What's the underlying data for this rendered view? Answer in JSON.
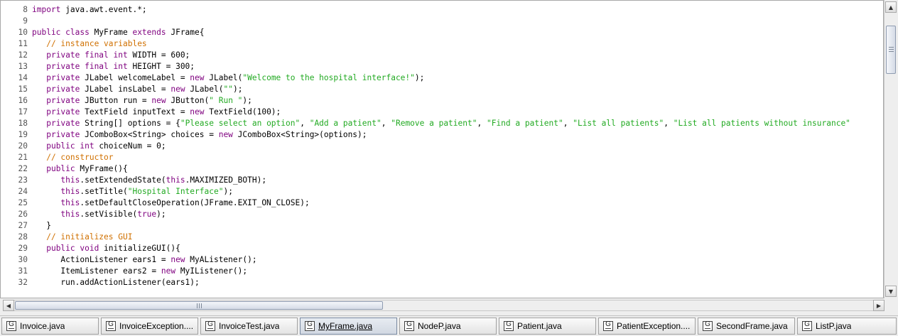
{
  "editor": {
    "lines": [
      {
        "n": "8",
        "tokens": [
          {
            "c": "kw",
            "t": "import"
          },
          {
            "c": "",
            "t": " java.awt.event.*;"
          }
        ]
      },
      {
        "n": "9",
        "tokens": []
      },
      {
        "n": "10",
        "tokens": [
          {
            "c": "kw",
            "t": "public class"
          },
          {
            "c": "",
            "t": " MyFrame "
          },
          {
            "c": "kw",
            "t": "extends"
          },
          {
            "c": "",
            "t": " JFrame{"
          }
        ]
      },
      {
        "n": "11",
        "tokens": [
          {
            "c": "",
            "t": "   "
          },
          {
            "c": "cmt",
            "t": "// instance variables"
          }
        ]
      },
      {
        "n": "12",
        "tokens": [
          {
            "c": "",
            "t": "   "
          },
          {
            "c": "kw",
            "t": "private final int"
          },
          {
            "c": "",
            "t": " WIDTH = 600;"
          }
        ]
      },
      {
        "n": "13",
        "tokens": [
          {
            "c": "",
            "t": "   "
          },
          {
            "c": "kw",
            "t": "private final int"
          },
          {
            "c": "",
            "t": " HEIGHT = 300;"
          }
        ]
      },
      {
        "n": "14",
        "tokens": [
          {
            "c": "",
            "t": "   "
          },
          {
            "c": "kw",
            "t": "private"
          },
          {
            "c": "",
            "t": " JLabel welcomeLabel = "
          },
          {
            "c": "kw",
            "t": "new"
          },
          {
            "c": "",
            "t": " JLabel("
          },
          {
            "c": "str",
            "t": "\"Welcome to the hospital interface!\""
          },
          {
            "c": "",
            "t": ");"
          }
        ]
      },
      {
        "n": "15",
        "tokens": [
          {
            "c": "",
            "t": "   "
          },
          {
            "c": "kw",
            "t": "private"
          },
          {
            "c": "",
            "t": " JLabel insLabel = "
          },
          {
            "c": "kw",
            "t": "new"
          },
          {
            "c": "",
            "t": " JLabel("
          },
          {
            "c": "str",
            "t": "\"\""
          },
          {
            "c": "",
            "t": ");"
          }
        ]
      },
      {
        "n": "16",
        "tokens": [
          {
            "c": "",
            "t": "   "
          },
          {
            "c": "kw",
            "t": "private"
          },
          {
            "c": "",
            "t": " JButton run = "
          },
          {
            "c": "kw",
            "t": "new"
          },
          {
            "c": "",
            "t": " JButton("
          },
          {
            "c": "str",
            "t": "\" Run \""
          },
          {
            "c": "",
            "t": ");"
          }
        ]
      },
      {
        "n": "17",
        "tokens": [
          {
            "c": "",
            "t": "   "
          },
          {
            "c": "kw",
            "t": "private"
          },
          {
            "c": "",
            "t": " TextField inputText = "
          },
          {
            "c": "kw",
            "t": "new"
          },
          {
            "c": "",
            "t": " TextField(100);"
          }
        ]
      },
      {
        "n": "18",
        "tokens": [
          {
            "c": "",
            "t": "   "
          },
          {
            "c": "kw",
            "t": "private"
          },
          {
            "c": "",
            "t": " String[] options = {"
          },
          {
            "c": "str",
            "t": "\"Please select an option\""
          },
          {
            "c": "",
            "t": ", "
          },
          {
            "c": "str",
            "t": "\"Add a patient\""
          },
          {
            "c": "",
            "t": ", "
          },
          {
            "c": "str",
            "t": "\"Remove a patient\""
          },
          {
            "c": "",
            "t": ", "
          },
          {
            "c": "str",
            "t": "\"Find a patient\""
          },
          {
            "c": "",
            "t": ", "
          },
          {
            "c": "str",
            "t": "\"List all patients\""
          },
          {
            "c": "",
            "t": ", "
          },
          {
            "c": "str",
            "t": "\"List all patients without insurance\""
          }
        ]
      },
      {
        "n": "19",
        "tokens": [
          {
            "c": "",
            "t": "   "
          },
          {
            "c": "kw",
            "t": "private"
          },
          {
            "c": "",
            "t": " JComboBox<String> choices = "
          },
          {
            "c": "kw",
            "t": "new"
          },
          {
            "c": "",
            "t": " JComboBox<String>(options);"
          }
        ]
      },
      {
        "n": "20",
        "tokens": [
          {
            "c": "",
            "t": "   "
          },
          {
            "c": "kw",
            "t": "public int"
          },
          {
            "c": "",
            "t": " choiceNum = 0;"
          }
        ]
      },
      {
        "n": "21",
        "tokens": [
          {
            "c": "",
            "t": "   "
          },
          {
            "c": "cmt",
            "t": "// constructor"
          }
        ]
      },
      {
        "n": "22",
        "tokens": [
          {
            "c": "",
            "t": "   "
          },
          {
            "c": "kw",
            "t": "public"
          },
          {
            "c": "",
            "t": " MyFrame(){"
          }
        ]
      },
      {
        "n": "23",
        "tokens": [
          {
            "c": "",
            "t": "      "
          },
          {
            "c": "kw",
            "t": "this"
          },
          {
            "c": "",
            "t": ".setExtendedState("
          },
          {
            "c": "kw",
            "t": "this"
          },
          {
            "c": "",
            "t": ".MAXIMIZED_BOTH);"
          }
        ]
      },
      {
        "n": "24",
        "tokens": [
          {
            "c": "",
            "t": "      "
          },
          {
            "c": "kw",
            "t": "this"
          },
          {
            "c": "",
            "t": ".setTitle("
          },
          {
            "c": "str",
            "t": "\"Hospital Interface\""
          },
          {
            "c": "",
            "t": ");"
          }
        ]
      },
      {
        "n": "25",
        "tokens": [
          {
            "c": "",
            "t": "      "
          },
          {
            "c": "kw",
            "t": "this"
          },
          {
            "c": "",
            "t": ".setDefaultCloseOperation(JFrame.EXIT_ON_CLOSE);"
          }
        ]
      },
      {
        "n": "26",
        "tokens": [
          {
            "c": "",
            "t": "      "
          },
          {
            "c": "kw",
            "t": "this"
          },
          {
            "c": "",
            "t": ".setVisible("
          },
          {
            "c": "kw",
            "t": "true"
          },
          {
            "c": "",
            "t": ");"
          }
        ]
      },
      {
        "n": "27",
        "tokens": [
          {
            "c": "",
            "t": "   }"
          }
        ]
      },
      {
        "n": "28",
        "tokens": [
          {
            "c": "",
            "t": "   "
          },
          {
            "c": "cmt",
            "t": "// initializes GUI"
          }
        ]
      },
      {
        "n": "29",
        "tokens": [
          {
            "c": "",
            "t": "   "
          },
          {
            "c": "kw",
            "t": "public void"
          },
          {
            "c": "",
            "t": " initializeGUI(){"
          }
        ]
      },
      {
        "n": "30",
        "tokens": [
          {
            "c": "",
            "t": "      ActionListener ears1 = "
          },
          {
            "c": "kw",
            "t": "new"
          },
          {
            "c": "",
            "t": " MyAListener();"
          }
        ]
      },
      {
        "n": "31",
        "tokens": [
          {
            "c": "",
            "t": "      ItemListener ears2 = "
          },
          {
            "c": "kw",
            "t": "new"
          },
          {
            "c": "",
            "t": " MyIListener();"
          }
        ]
      },
      {
        "n": "32",
        "tokens": [
          {
            "c": "",
            "t": "      run.addActionListener(ears1);"
          }
        ]
      }
    ]
  },
  "scrollbars": {
    "up_icon": "arrow-up-icon",
    "down_icon": "arrow-down-icon",
    "left_icon": "arrow-left-icon",
    "right_icon": "arrow-right-icon",
    "up_glyph": "▲",
    "down_glyph": "▼",
    "left_glyph": "◀",
    "right_glyph": "▶"
  },
  "tabs": {
    "icon_letter": "G",
    "items": [
      {
        "label": "Invoice.java",
        "active": false
      },
      {
        "label": "InvoiceException....",
        "active": false
      },
      {
        "label": "InvoiceTest.java",
        "active": false
      },
      {
        "label": "MyFrame.java",
        "active": true
      },
      {
        "label": "NodeP.java",
        "active": false
      },
      {
        "label": "Patient.java",
        "active": false
      },
      {
        "label": "PatientException....",
        "active": false
      },
      {
        "label": "SecondFrame.java",
        "active": false
      },
      {
        "label": "ListP.java",
        "active": false
      }
    ]
  },
  "colors": {
    "keyword": "#7f007f",
    "string": "#22aa22",
    "comment": "#d07000",
    "line_number": "#555555"
  }
}
